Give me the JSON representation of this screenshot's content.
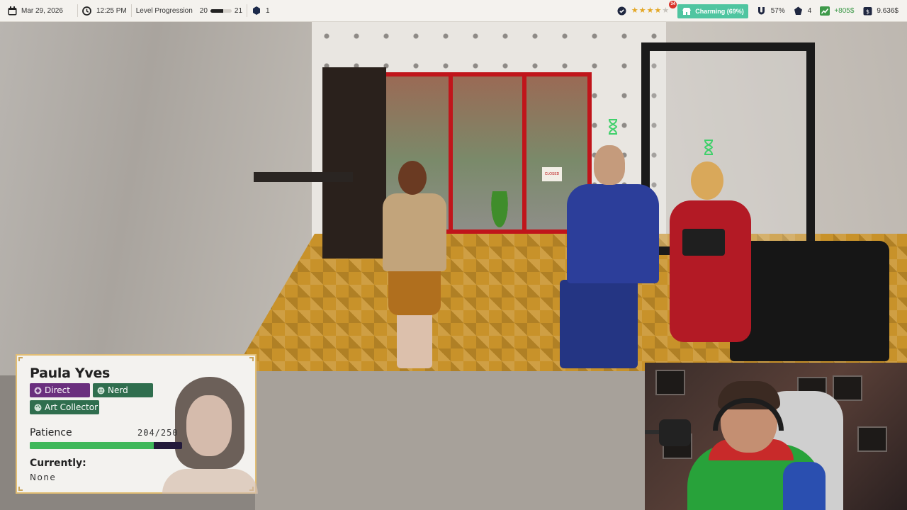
{
  "hud": {
    "date": "Mar 29, 2026",
    "time": "12:25 PM",
    "level_label": "Level Progression",
    "level_current": "20",
    "level_next": "21",
    "level_progress": 0.6,
    "cards": "1",
    "rating_stars_filled": 4,
    "rating_stars_total": 5,
    "rating_badge": "34",
    "charm_label": "Charming (69%)",
    "magnet_value": "57%",
    "tokens": "4",
    "profit": "+805$",
    "balance": "9.636$",
    "colors": {
      "charm": "#4fc5a0",
      "profit": "#3e9a4a",
      "star": "#e3a623"
    }
  },
  "customer": {
    "name": "Paula Yves",
    "traits": [
      {
        "label": "Direct",
        "color": "#6a2f7e",
        "icon": "diamond-icon"
      },
      {
        "label": "Nerd",
        "color": "#2f6e4e",
        "icon": "smiley-icon"
      },
      {
        "label": "Art Collector",
        "color": "#2f6e4e",
        "icon": "palette-icon"
      }
    ],
    "patience_label": "Patience",
    "patience_value": "204/250",
    "patience_fraction": 0.816,
    "currently_label": "Currently:",
    "currently_value": "None"
  },
  "scene": {
    "sign_text": "CLOSED"
  }
}
